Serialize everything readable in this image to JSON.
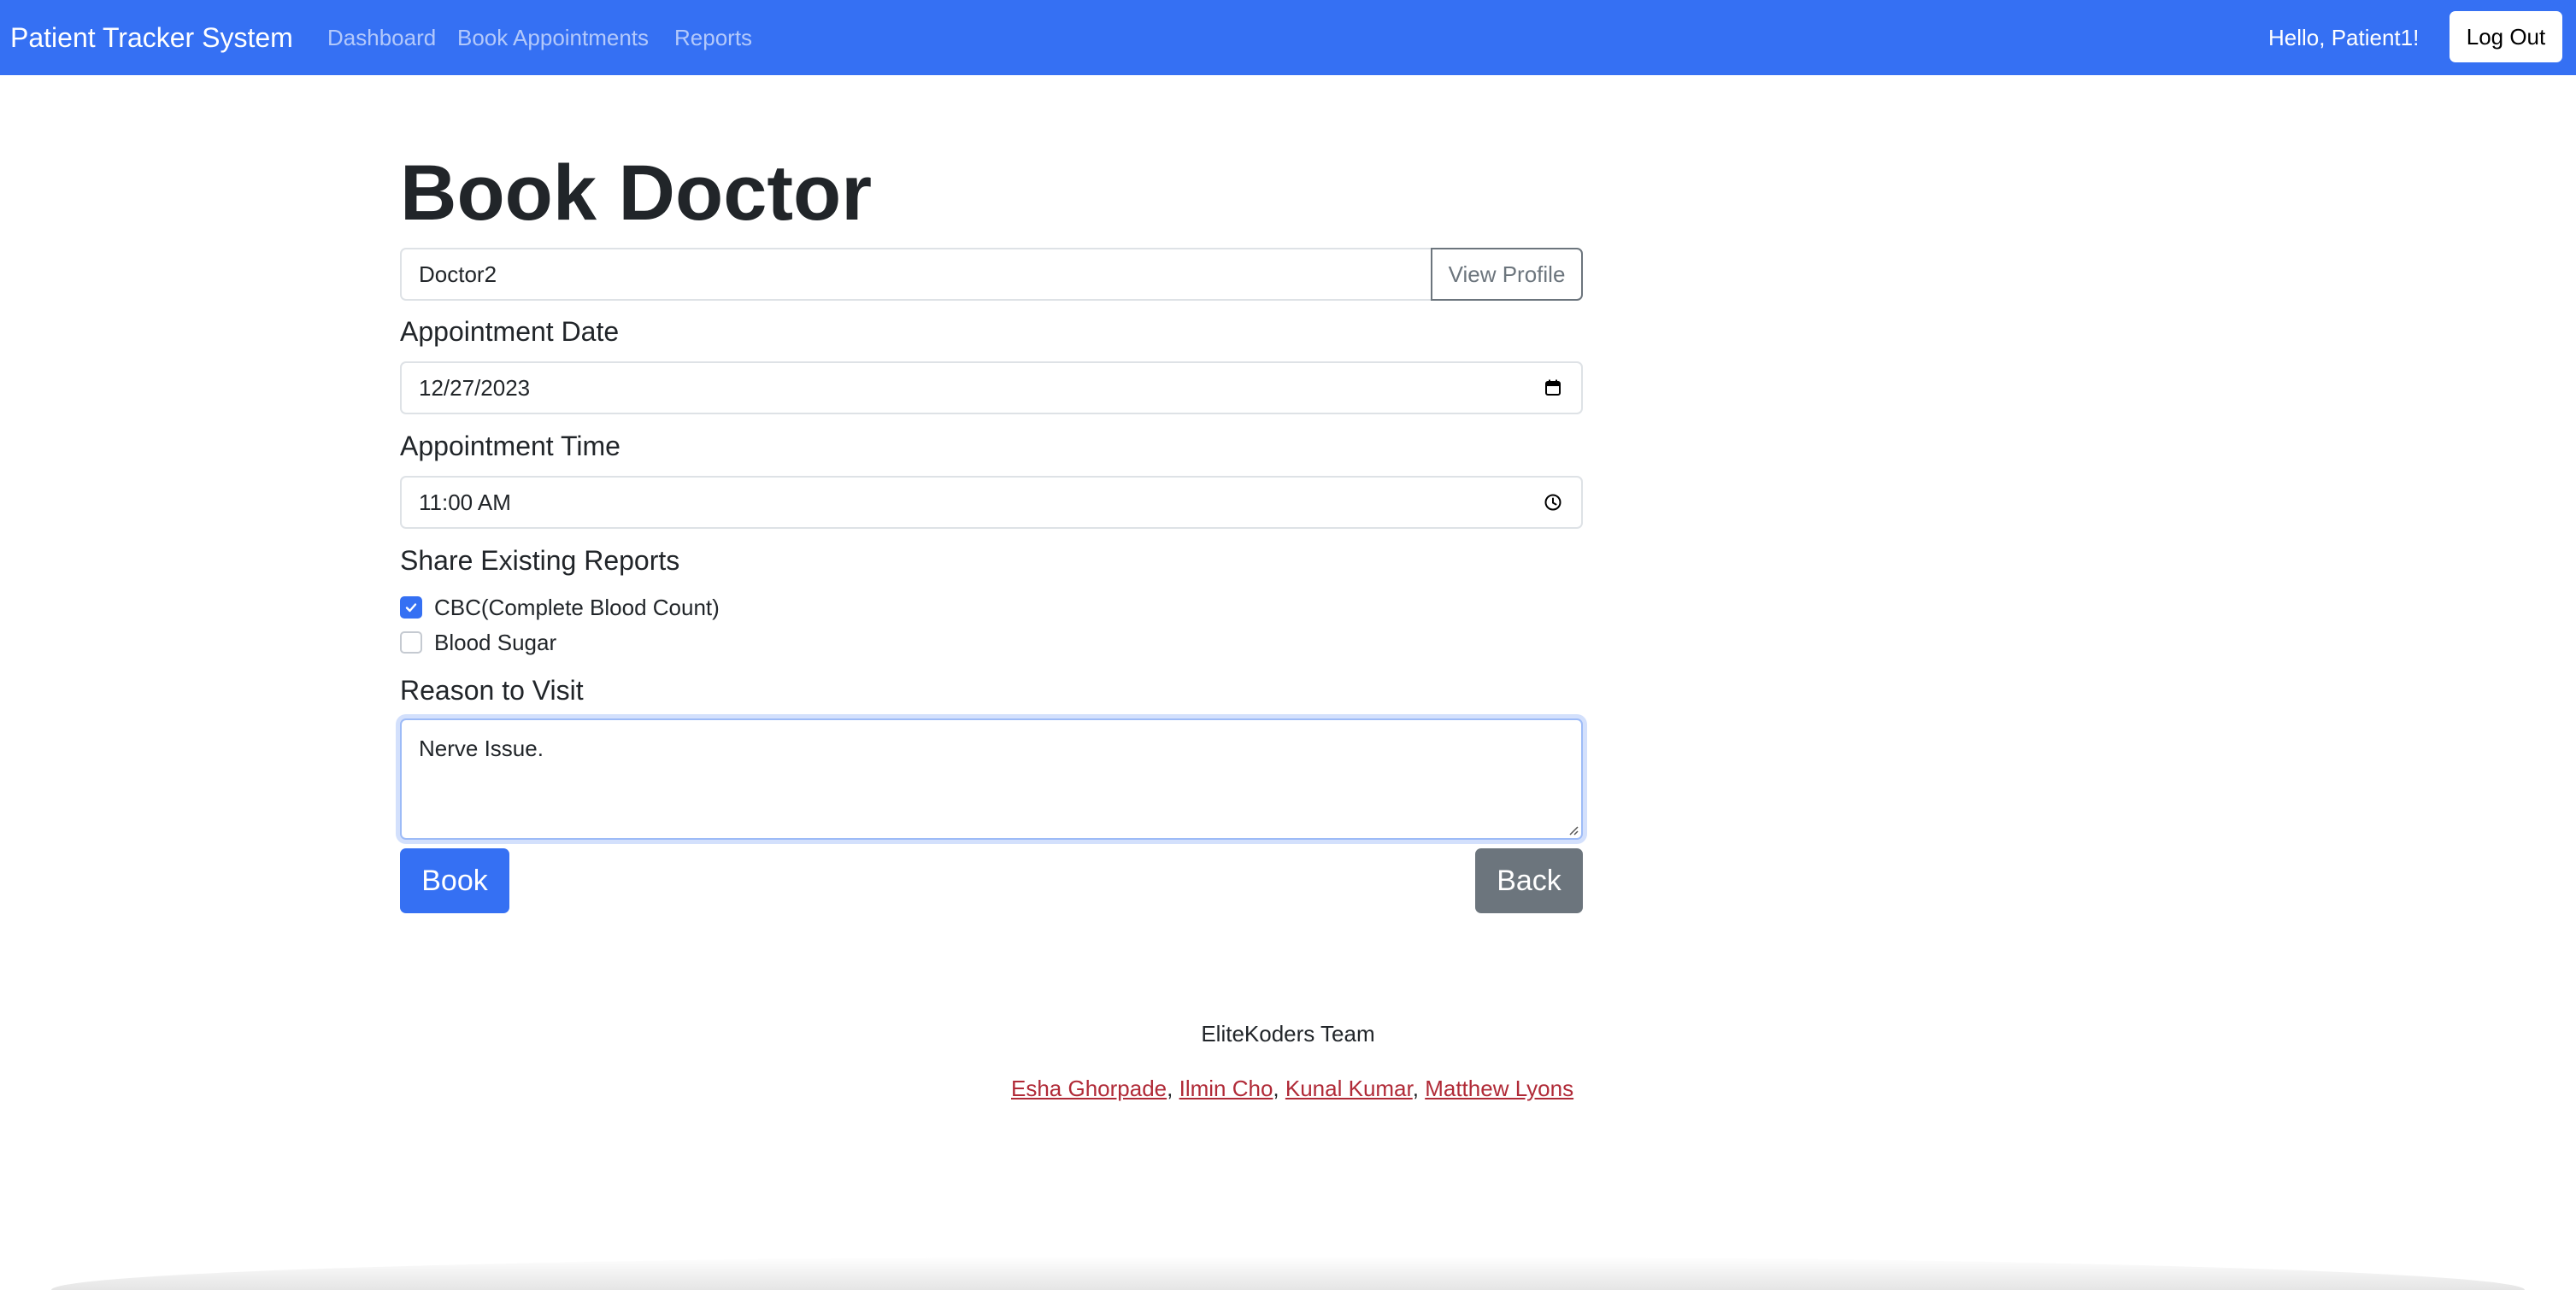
{
  "navbar": {
    "brand": "Patient Tracker System",
    "links": [
      "Dashboard",
      "Book Appointments",
      "Reports"
    ],
    "greeting": "Hello, Patient1!",
    "logout_label": "Log Out",
    "background_color": "#3570f3"
  },
  "form": {
    "title": "Book Doctor",
    "doctor_value": "Doctor2",
    "view_profile_label": "View Profile",
    "date_label": "Appointment Date",
    "date_value": "12/27/2023",
    "date_icon": "calendar-icon",
    "time_label": "Appointment Time",
    "time_value": "11:00 AM",
    "time_icon": "clock-icon",
    "reports_label": "Share Existing Reports",
    "reports": [
      {
        "label": "CBC(Complete Blood Count)",
        "checked": true
      },
      {
        "label": "Blood Sugar",
        "checked": false
      }
    ],
    "reason_label": "Reason to Visit",
    "reason_value": "Nerve Issue.",
    "book_label": "Book",
    "back_label": "Back"
  },
  "footer": {
    "team": "EliteKoders Team",
    "members": [
      "Esha Ghorpade",
      "Ilmin Cho",
      "Kunal Kumar",
      "Matthew Lyons"
    ],
    "separator": ", "
  }
}
